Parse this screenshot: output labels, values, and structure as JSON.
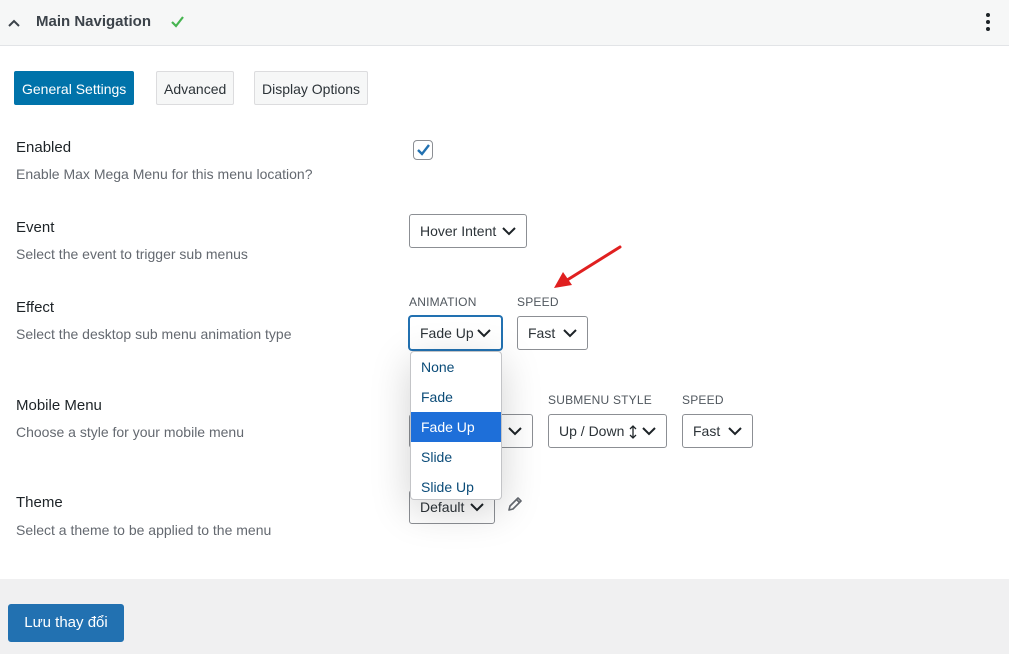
{
  "header": {
    "title": "Main Navigation"
  },
  "tabs": [
    {
      "label": "General Settings",
      "active": true
    },
    {
      "label": "Advanced",
      "active": false
    },
    {
      "label": "Display Options",
      "active": false
    }
  ],
  "settings": {
    "enabled": {
      "label": "Enabled",
      "description": "Enable Max Mega Menu for this menu location?",
      "checked": true
    },
    "event": {
      "label": "Event",
      "description": "Select the event to trigger sub menus",
      "value": "Hover Intent"
    },
    "effect": {
      "label": "Effect",
      "description": "Select the desktop sub menu animation type",
      "animation_label": "ANIMATION",
      "animation_value": "Fade Up",
      "speed_label": "SPEED",
      "speed_value": "Fast",
      "animation_options": [
        "None",
        "Fade",
        "Fade Up",
        "Slide",
        "Slide Up"
      ],
      "selected_option": "Fade Up"
    },
    "mobile_menu": {
      "label": "Mobile Menu",
      "description": "Choose a style for your mobile menu",
      "submenu_style_label": "SUBMENU STYLE",
      "submenu_style_value": "Up / Down",
      "speed_label": "SPEED",
      "speed_value": "Fast"
    },
    "theme": {
      "label": "Theme",
      "description": "Select a theme to be applied to the menu",
      "value": "Default"
    }
  },
  "footer": {
    "save_label": "Lưu thay đổi"
  },
  "colors": {
    "primary": "#2271b1",
    "tab_active": "#0073aa",
    "check": "#46b450",
    "selected_option": "#1e6fd9",
    "annotation_arrow": "#e02020"
  }
}
